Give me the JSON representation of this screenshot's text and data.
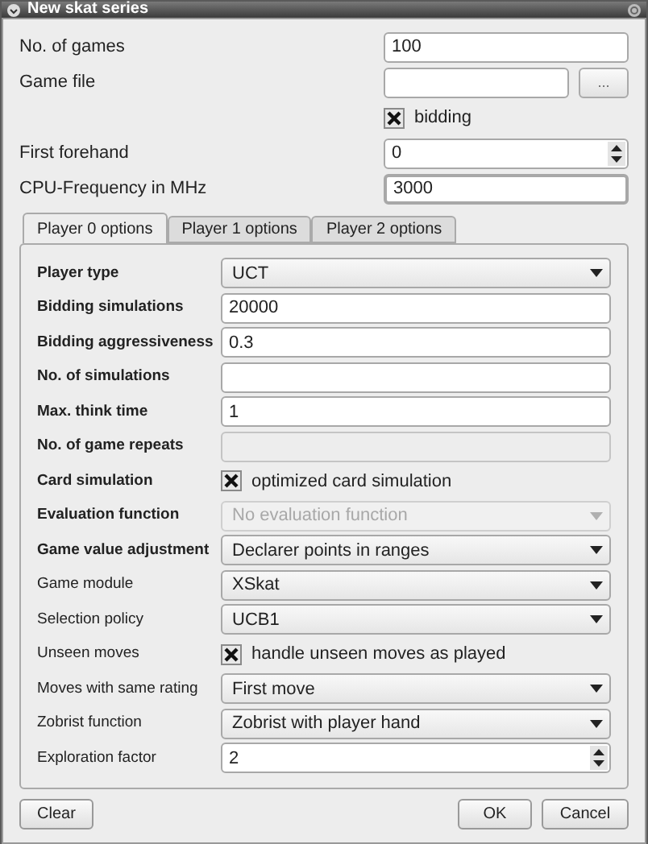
{
  "window": {
    "title": "New skat series"
  },
  "general": [
    {
      "kind": "text",
      "label": "No. of games",
      "value": "100"
    },
    {
      "kind": "file",
      "label": "Game file",
      "browse": "..."
    },
    {
      "kind": "check",
      "text": "bidding",
      "checked": true
    },
    {
      "kind": "spin",
      "label": "First forehand",
      "value": "0"
    },
    {
      "kind": "text",
      "label": "CPU-Frequency in MHz",
      "value": "3000",
      "focused": true
    }
  ],
  "tabs": [
    {
      "label": "Player 0 options",
      "selected": true
    },
    {
      "label": "Player 1 options",
      "selected": false
    },
    {
      "label": "Player 2 options",
      "selected": false
    }
  ],
  "options": [
    {
      "kind": "combo",
      "label": "Player type",
      "bold": true,
      "value": "UCT",
      "disabled": false
    },
    {
      "kind": "text",
      "label": "Bidding simulations",
      "bold": true,
      "value": "20000",
      "disabled": false
    },
    {
      "kind": "text",
      "label": "Bidding aggressiveness",
      "bold": true,
      "value": "0.3",
      "disabled": false
    },
    {
      "kind": "text",
      "label": "No. of simulations",
      "bold": true,
      "disabled": false
    },
    {
      "kind": "text",
      "label": "Max. think time",
      "bold": true,
      "value": "1",
      "disabled": false
    },
    {
      "kind": "text",
      "label": "No. of game repeats",
      "bold": true,
      "disabled": true
    },
    {
      "kind": "check",
      "label": "Card simulation",
      "bold": true,
      "text": "optimized card simulation",
      "checked": true
    },
    {
      "kind": "combo",
      "label": "Evaluation function",
      "bold": true,
      "value": "No evaluation function",
      "disabled": true
    },
    {
      "kind": "combo",
      "label": "Game value adjustment",
      "bold": true,
      "value": "Declarer points in ranges",
      "disabled": false
    },
    {
      "kind": "combo",
      "label": "Game module",
      "bold": false,
      "value": "XSkat",
      "disabled": false
    },
    {
      "kind": "combo",
      "label": "Selection policy",
      "bold": false,
      "value": "UCB1",
      "disabled": false
    },
    {
      "kind": "check",
      "label": "Unseen moves",
      "bold": false,
      "text": "handle unseen moves as played",
      "checked": true
    },
    {
      "kind": "combo",
      "label": "Moves with same rating",
      "bold": false,
      "value": "First move",
      "disabled": false
    },
    {
      "kind": "combo",
      "label": "Zobrist function",
      "bold": false,
      "value": "Zobrist with player hand",
      "disabled": false
    },
    {
      "kind": "spin",
      "label": "Exploration factor",
      "bold": false,
      "value": "2",
      "disabled": false
    }
  ],
  "buttons": [
    {
      "label": "Clear"
    },
    {
      "label": "OK"
    },
    {
      "label": "Cancel"
    }
  ]
}
